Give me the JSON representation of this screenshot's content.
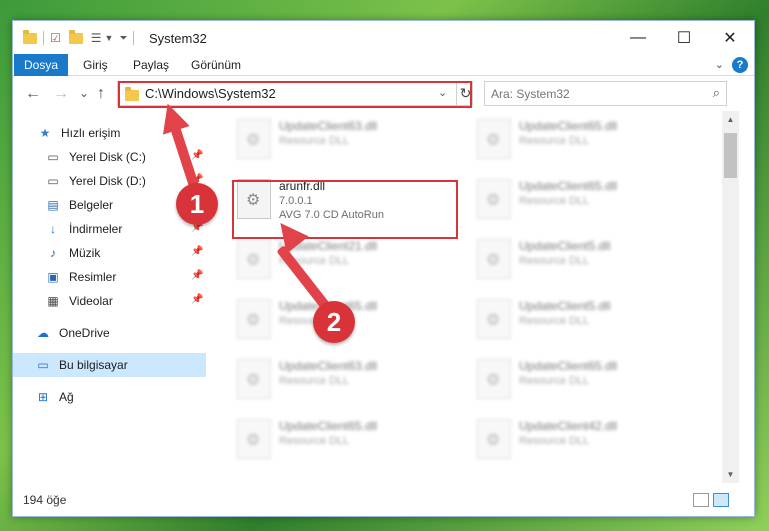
{
  "window": {
    "title": "System32",
    "controls": {
      "minimize": "—",
      "maximize": "☐",
      "close": "✕"
    }
  },
  "ribbon": {
    "tabs": [
      "Dosya",
      "Giriş",
      "Paylaş",
      "Görünüm"
    ],
    "help": "?"
  },
  "nav": {
    "back": "←",
    "forward": "→",
    "recent": "⌄",
    "up": "↑",
    "address": "C:\\Windows\\System32",
    "search_placeholder": "Ara: System32"
  },
  "sidebar": {
    "items": [
      {
        "label": "Hızlı erişim",
        "icon": "star-icon",
        "pinned": false
      },
      {
        "label": "Yerel Disk (C:)",
        "icon": "drive-icon",
        "pinned": true
      },
      {
        "label": "Yerel Disk (D:)",
        "icon": "drive-icon",
        "pinned": true
      },
      {
        "label": "Belgeler",
        "icon": "document-icon",
        "pinned": true
      },
      {
        "label": "İndirmeler",
        "icon": "download-icon",
        "pinned": true
      },
      {
        "label": "Müzik",
        "icon": "music-icon",
        "pinned": true
      },
      {
        "label": "Resimler",
        "icon": "pictures-icon",
        "pinned": true
      },
      {
        "label": "Videolar",
        "icon": "video-icon",
        "pinned": true
      },
      {
        "label": "OneDrive",
        "icon": "cloud-icon",
        "pinned": false
      },
      {
        "label": "Bu bilgisayar",
        "icon": "computer-icon",
        "pinned": false,
        "selected": true
      },
      {
        "label": "Ağ",
        "icon": "network-icon",
        "pinned": false
      }
    ]
  },
  "files": {
    "focused": {
      "name": "arunfr.dll",
      "version": "7.0.0.1",
      "description": "AVG 7.0 CD AutoRun"
    },
    "left": [
      {
        "name": "UpdateClient63.dll",
        "sub": "Resource DLL"
      },
      null,
      {
        "name": "UpdateClient21.dll",
        "sub": "Resource DLL"
      },
      {
        "name": "UpdateClient65.dll",
        "sub": "Resource DLL"
      },
      {
        "name": "UpdateClient63.dll",
        "sub": "Resource DLL"
      },
      {
        "name": "UpdateClient65.dll",
        "sub": "Resource DLL"
      }
    ],
    "right": [
      {
        "name": "UpdateClient65.dll",
        "sub": "Resource DLL"
      },
      {
        "name": "UpdateClient65.dll",
        "sub": "Resource DLL"
      },
      {
        "name": "UpdateClient5.dll",
        "sub": "Resource DLL"
      },
      {
        "name": "UpdateClient5.dll",
        "sub": "Resource DLL"
      },
      {
        "name": "UpdateClient65.dll",
        "sub": "Resource DLL"
      },
      {
        "name": "UpdateClient42.dll",
        "sub": "Resource DLL"
      }
    ]
  },
  "status": {
    "count": "194 öğe"
  },
  "annotations": {
    "step1": "1",
    "step2": "2",
    "color": "#d9333a"
  }
}
